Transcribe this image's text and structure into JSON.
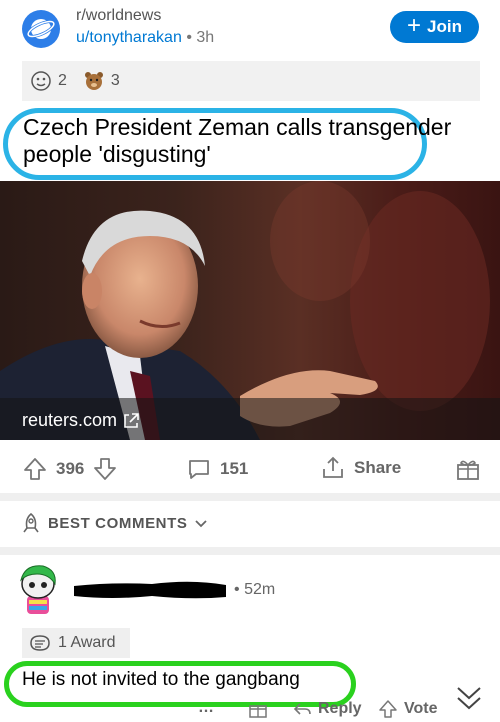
{
  "post": {
    "subreddit": "r/worldnews",
    "author": "u/tonytharakan",
    "separator": "•",
    "age": "3h",
    "join_label": "Join",
    "awards": [
      {
        "icon": "award-face-icon",
        "count": "2"
      },
      {
        "icon": "award-bear-icon",
        "count": "3"
      }
    ],
    "title": "Czech President Zeman calls transgender people 'disgusting'",
    "link_domain": "reuters.com",
    "upvotes": "396",
    "comments": "151",
    "share_label": "Share"
  },
  "comments_section": {
    "sort_label": "BEST COMMENTS"
  },
  "comment": {
    "separator": "•",
    "age": "52m",
    "award_label": "1 Award",
    "body": "He is not invited to the gangbang",
    "more": "…",
    "reply_label": "Reply",
    "vote_label": "Vote"
  },
  "colors": {
    "accent": "#0079d3",
    "title_highlight": "#2bb3e6",
    "comment_highlight": "#2ad11e"
  }
}
